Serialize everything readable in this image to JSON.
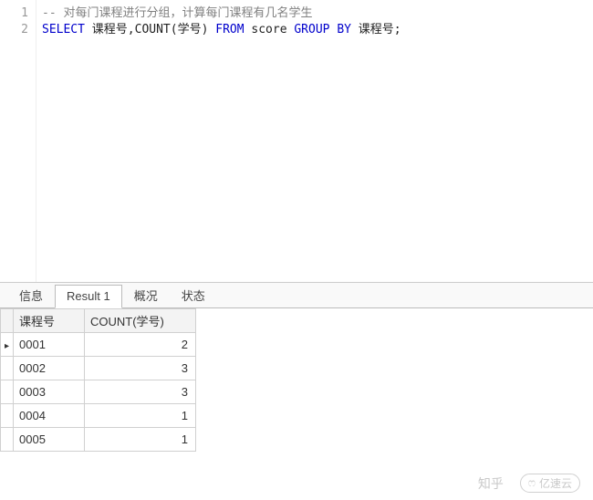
{
  "code": {
    "line_nos": [
      "1",
      "2"
    ],
    "l1_comment": "-- 对每门课程进行分组，计算每门课程有几名学生",
    "l2_kw1": "SELECT",
    "l2_p1": " 课程号,COUNT(学号) ",
    "l2_kw2": "FROM",
    "l2_p2": " score ",
    "l2_kw3": "GROUP BY",
    "l2_p3": " 课程号;"
  },
  "tabs": {
    "info": "信息",
    "result1": "Result 1",
    "profile": "概况",
    "status": "状态",
    "active": "result1"
  },
  "grid": {
    "headers": {
      "col1": "课程号",
      "col2": "COUNT(学号)"
    },
    "rows": [
      {
        "c1": "0001",
        "c2": "2",
        "current": true
      },
      {
        "c1": "0002",
        "c2": "3",
        "current": false
      },
      {
        "c1": "0003",
        "c2": "3",
        "current": false
      },
      {
        "c1": "0004",
        "c2": "1",
        "current": false
      },
      {
        "c1": "0005",
        "c2": "1",
        "current": false
      }
    ]
  },
  "watermark": {
    "zhihu": "知乎",
    "yisu": "亿速云"
  }
}
